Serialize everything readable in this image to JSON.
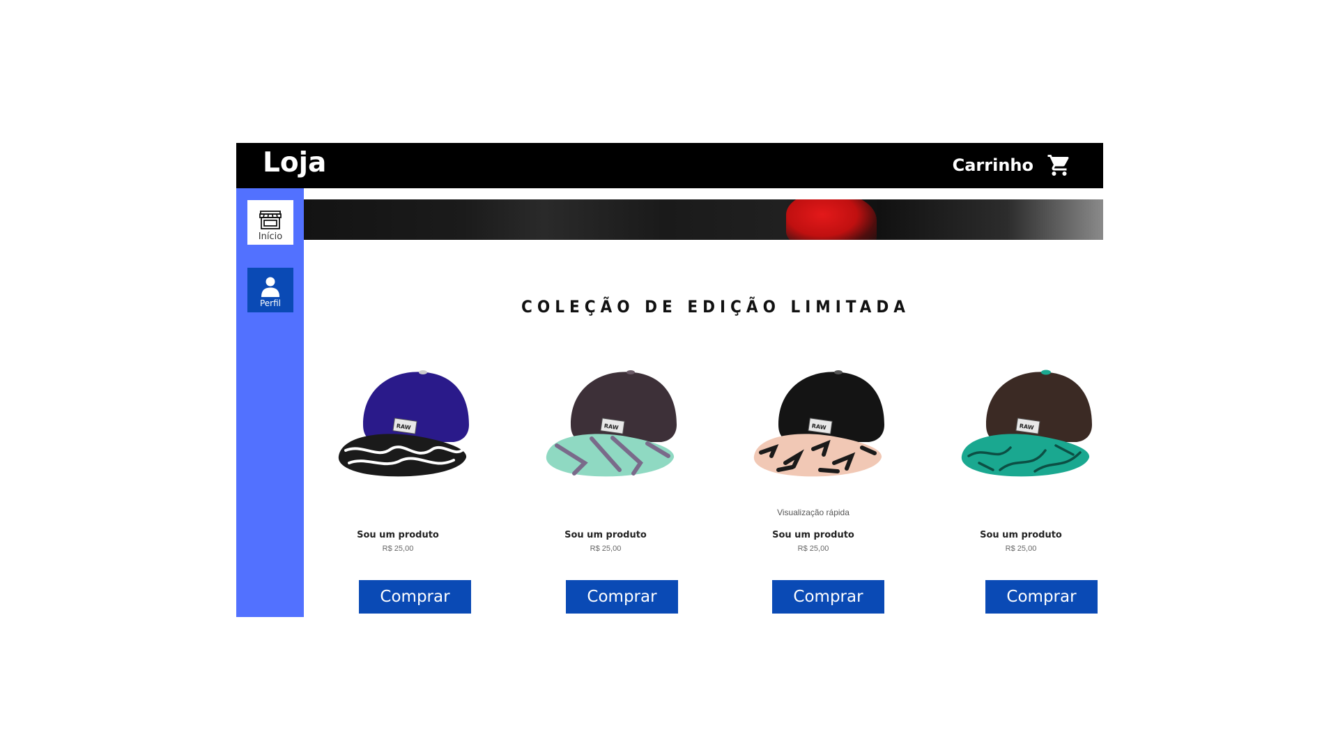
{
  "header": {
    "brand": "Loja",
    "cart_label": "Carrinho",
    "cart_icon": "shopping-cart-icon"
  },
  "sidebar": {
    "items": [
      {
        "label": "Início",
        "icon": "store-icon",
        "active": true
      },
      {
        "label": "Perfil",
        "icon": "user-icon",
        "active": false
      }
    ]
  },
  "main": {
    "title": "COLEÇÃO DE EDIÇÃO LIMITADA",
    "products": [
      {
        "name": "Sou um produto",
        "price": "R$ 25,00",
        "buy_label": "Comprar",
        "crown": "#2a1a8a",
        "brim": "#1a1a1a",
        "quick_view": ""
      },
      {
        "name": "Sou um produto",
        "price": "R$ 25,00",
        "buy_label": "Comprar",
        "crown": "#3d3038",
        "brim": "#8fd9c2",
        "quick_view": ""
      },
      {
        "name": "Sou um produto",
        "price": "R$ 25,00",
        "buy_label": "Comprar",
        "crown": "#141414",
        "brim": "#f1c8b5",
        "quick_view": "Visualização rápida"
      },
      {
        "name": "Sou um produto",
        "price": "R$ 25,00",
        "buy_label": "Comprar",
        "crown": "#3b2a24",
        "brim": "#1aa890",
        "quick_view": ""
      }
    ]
  },
  "colors": {
    "header_bg": "#000000",
    "sidebar_bg": "#5271ff",
    "button_bg": "#0a4ab5",
    "hero_accent": "#e3191a"
  }
}
